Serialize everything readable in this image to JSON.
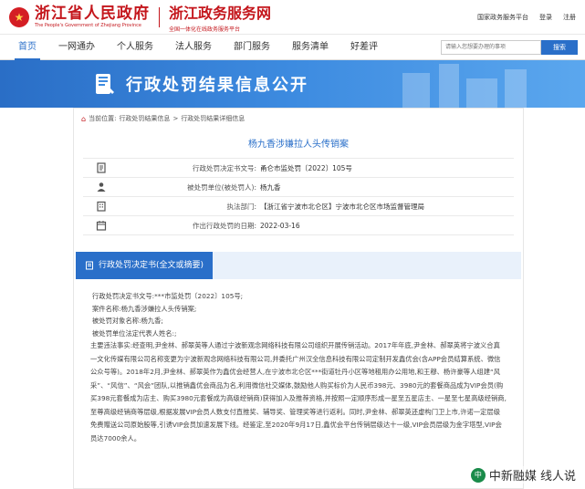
{
  "header": {
    "site_name": "浙江省人民政府",
    "site_name_en": "The People's Government of Zhejiang Province",
    "service_name": "浙江政务服务网",
    "service_sub": "全国一体化在线政务服务平台",
    "links": [
      "国家政务服务平台",
      "登录",
      "注册"
    ]
  },
  "nav": {
    "items": [
      "首页",
      "一网通办",
      "个人服务",
      "法人服务",
      "部门服务",
      "服务清单",
      "好差评"
    ],
    "active_index": 0,
    "search_placeholder": "请输入您想要办理的事项",
    "search_button": "搜索"
  },
  "banner": {
    "title": "行政处罚结果信息公开"
  },
  "breadcrumb": {
    "prefix": "当前位置:",
    "items": [
      "行政处罚结果信息",
      "行政处罚结果详细信息"
    ],
    "separator": ">"
  },
  "doc": {
    "title": "杨九香涉嫌拉人头传销案",
    "rows": [
      {
        "icon": "document-icon",
        "label": "行政处罚决定书文号:",
        "value": "甬仑市监处罚〔2022〕105号"
      },
      {
        "icon": "person-icon",
        "label": "被处罚单位(被处罚人):",
        "value": "杨九香"
      },
      {
        "icon": "building-icon",
        "label": "执法部门:",
        "value": "【浙江省宁波市北仑区】宁波市北仑区市场监督管理局"
      },
      {
        "icon": "calendar-icon",
        "label": "作出行政处罚的日期:",
        "value": "2022-03-16"
      }
    ]
  },
  "section": {
    "tab": "行政处罚决定书(全文或摘要)"
  },
  "body": {
    "meta": [
      "行政处罚决定书文号:***市监处罚〔2022〕105号;",
      "案件名称:杨九香涉嫌拉人头传销案;",
      "被处罚对象名称:杨九香;",
      "被处罚单位法定代表人姓名:;"
    ],
    "text": "主要违法事实:经查明,尹金林、郝翠英等人通过宁波新观念网络科技有限公司组织开展传销活动。2017年年底,尹金林、郝翠英将宁波义合真一文化传媒有限公司名称变更为宁波新观念网络科技有限公司,并委托广州汉全信息科技有限公司定制开发鑫优会(含APP会员结算系统、微信公众号等)。2018年2月,尹金林、郝翠英作为鑫优会经营人,在宁波市北仑区***街道牡丹小区等地租用办公用地,和王穆、杨许豪等人组建“风采”、“风信”、“风会”团队,以推销鑫优会商品为名,利用微信社交媒体,鼓励他人购买标价为人民币398元、3980元的套餐商品成为VIP会员(购买398元套餐成为店主、购买3980元套餐成为高级经销商)获得加入及推荐资格,并按照一定顺序形成一星至五星店主、一星至七星高级经销商,至尊高级经销商等层级,根据发展VIP会员人数支付直推奖、辅导奖、管理奖等进行返利。同时,尹金林、郝翠英还虚构门卫上市,许诺一定层级免费赠送公司原始股等,引诱VIP会员加速发展下线。经鉴定,至2020年9月17日,鑫优会平台传销层级达十一级,VIP会员层级为金字塔型,VIP会员达7000余人。"
  },
  "watermark": {
    "text": "中新融媒 线人说"
  },
  "colors": {
    "brand_red": "#c4161c",
    "accent_blue": "#2a6fc9"
  }
}
